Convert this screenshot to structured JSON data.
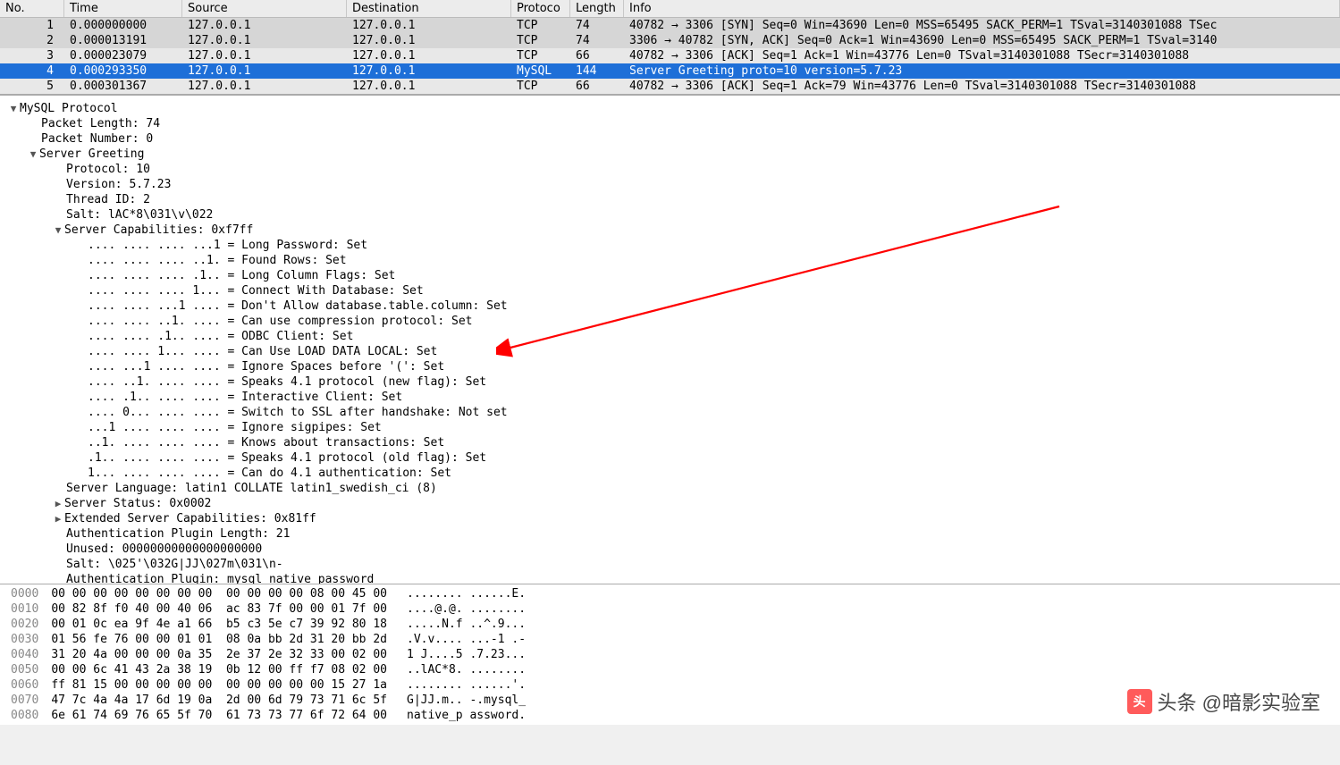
{
  "columns": {
    "no": "No.",
    "time": "Time",
    "src": "Source",
    "dst": "Destination",
    "proto": "Protoco",
    "len": "Length",
    "info": "Info"
  },
  "packets": [
    {
      "no": "1",
      "time": "0.000000000",
      "src": "127.0.0.1",
      "dst": "127.0.0.1",
      "proto": "TCP",
      "len": "74",
      "info": "40782 → 3306 [SYN] Seq=0 Win=43690 Len=0 MSS=65495 SACK_PERM=1 TSval=3140301088 TSec",
      "style": "row-gray"
    },
    {
      "no": "2",
      "time": "0.000013191",
      "src": "127.0.0.1",
      "dst": "127.0.0.1",
      "proto": "TCP",
      "len": "74",
      "info": "3306 → 40782 [SYN, ACK] Seq=0 Ack=1 Win=43690 Len=0 MSS=65495 SACK_PERM=1 TSval=3140",
      "style": "row-gray"
    },
    {
      "no": "3",
      "time": "0.000023079",
      "src": "127.0.0.1",
      "dst": "127.0.0.1",
      "proto": "TCP",
      "len": "66",
      "info": "40782 → 3306 [ACK] Seq=1 Ack=1 Win=43776 Len=0 TSval=3140301088 TSecr=3140301088",
      "style": "row-lightgray"
    },
    {
      "no": "4",
      "time": "0.000293350",
      "src": "127.0.0.1",
      "dst": "127.0.0.1",
      "proto": "MySQL",
      "len": "144",
      "info": "Server Greeting proto=10 version=5.7.23",
      "style": "row-selected"
    },
    {
      "no": "5",
      "time": "0.000301367",
      "src": "127.0.0.1",
      "dst": "127.0.0.1",
      "proto": "TCP",
      "len": "66",
      "info": "40782 → 3306 [ACK] Seq=1 Ack=79 Win=43776 Len=0 TSval=3140301088 TSecr=3140301088",
      "style": "row-lightgray"
    }
  ],
  "details": {
    "root": "MySQL Protocol",
    "packet_length": "Packet Length: 74",
    "packet_number": "Packet Number: 0",
    "server_greeting": "Server Greeting",
    "protocol": "Protocol: 10",
    "version": "Version: 5.7.23",
    "thread_id": "Thread ID: 2",
    "salt1": "Salt: lAC*8\\031\\v\\022",
    "server_caps": "Server Capabilities: 0xf7ff",
    "caps": [
      ".... .... .... ...1 = Long Password: Set",
      ".... .... .... ..1. = Found Rows: Set",
      ".... .... .... .1.. = Long Column Flags: Set",
      ".... .... .... 1... = Connect With Database: Set",
      ".... .... ...1 .... = Don't Allow database.table.column: Set",
      ".... .... ..1. .... = Can use compression protocol: Set",
      ".... .... .1.. .... = ODBC Client: Set",
      ".... .... 1... .... = Can Use LOAD DATA LOCAL: Set",
      ".... ...1 .... .... = Ignore Spaces before '(': Set",
      ".... ..1. .... .... = Speaks 4.1 protocol (new flag): Set",
      ".... .1.. .... .... = Interactive Client: Set",
      ".... 0... .... .... = Switch to SSL after handshake: Not set",
      "...1 .... .... .... = Ignore sigpipes: Set",
      "..1. .... .... .... = Knows about transactions: Set",
      ".1.. .... .... .... = Speaks 4.1 protocol (old flag): Set",
      "1... .... .... .... = Can do 4.1 authentication: Set"
    ],
    "server_language": "Server Language: latin1 COLLATE latin1_swedish_ci (8)",
    "server_status": "Server Status: 0x0002",
    "ext_caps": "Extended Server Capabilities: 0x81ff",
    "auth_plugin_len": "Authentication Plugin Length: 21",
    "unused": "Unused: 00000000000000000000",
    "salt2": "Salt: \\025'\\032G|JJ\\027m\\031\\n-",
    "auth_plugin": "Authentication Plugin: mysql_native_password"
  },
  "hex": [
    {
      "off": "0000",
      "b": "00 00 00 00 00 00 00 00  00 00 00 00 08 00 45 00",
      "a": "........ ......E."
    },
    {
      "off": "0010",
      "b": "00 82 8f f0 40 00 40 06  ac 83 7f 00 00 01 7f 00",
      "a": "....@.@. ........"
    },
    {
      "off": "0020",
      "b": "00 01 0c ea 9f 4e a1 66  b5 c3 5e c7 39 92 80 18",
      "a": ".....N.f ..^.9..."
    },
    {
      "off": "0030",
      "b": "01 56 fe 76 00 00 01 01  08 0a bb 2d 31 20 bb 2d",
      "a": ".V.v.... ...-1 .-"
    },
    {
      "off": "0040",
      "b": "31 20 4a 00 00 00 0a 35  2e 37 2e 32 33 00 02 00",
      "a": "1 J....5 .7.23..."
    },
    {
      "off": "0050",
      "b": "00 00 6c 41 43 2a 38 19  0b 12 00 ff f7 08 02 00",
      "a": "..lAC*8. ........"
    },
    {
      "off": "0060",
      "b": "ff 81 15 00 00 00 00 00  00 00 00 00 00 15 27 1a",
      "a": "........ ......'."
    },
    {
      "off": "0070",
      "b": "47 7c 4a 4a 17 6d 19 0a  2d 00 6d 79 73 71 6c 5f",
      "a": "G|JJ.m.. -.mysql_"
    },
    {
      "off": "0080",
      "b": "6e 61 74 69 76 65 5f 70  61 73 73 77 6f 72 64 00",
      "a": "native_p assword."
    }
  ],
  "watermark": "头条 @暗影实验室"
}
